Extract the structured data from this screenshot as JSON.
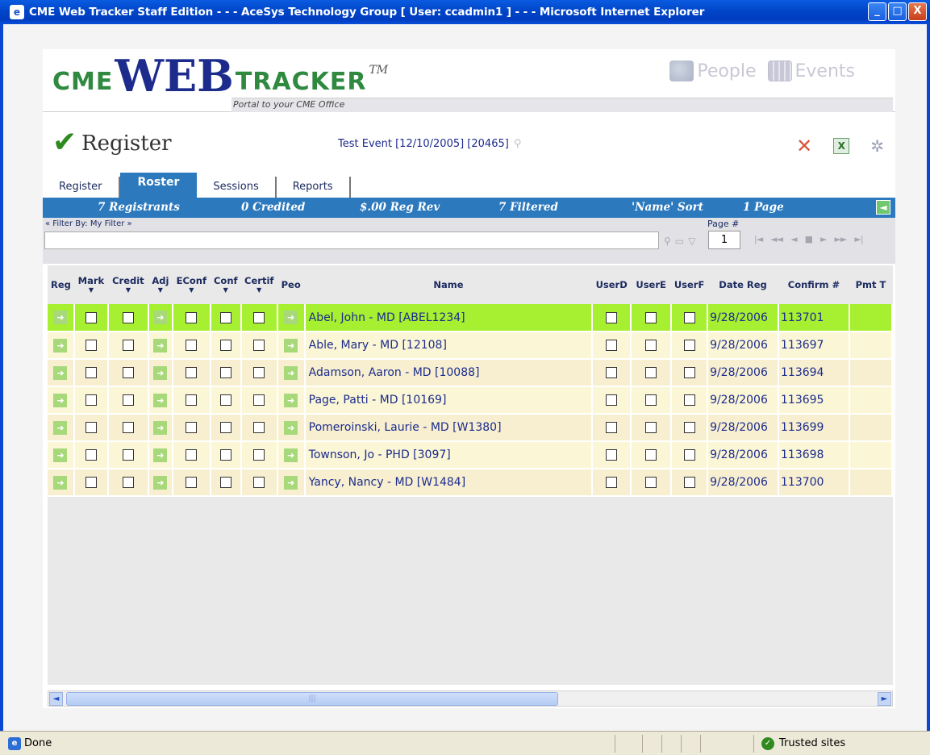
{
  "window": {
    "title": "CME Web Tracker Staff Edition - - - AceSys Technology Group [ User: ccadmin1 ] - - - Microsoft Internet Explorer",
    "minimize_label": "_",
    "maximize_label": "□",
    "close_label": "X"
  },
  "header": {
    "logo_cme": "CME",
    "logo_web": "WEB",
    "logo_tracker": "TRACKER",
    "logo_tm": "TM",
    "tagline": "Portal to your CME Office",
    "nav_people": "People",
    "nav_events": "Events"
  },
  "register": {
    "title": "Register",
    "event": "Test Event [12/10/2005] [20465]"
  },
  "tabs": [
    "Register",
    "Roster",
    "Sessions",
    "Reports"
  ],
  "active_tab": "Roster",
  "stats": {
    "registrants": "7 Registrants",
    "credited": "0 Credited",
    "reg_rev": "$.00 Reg Rev",
    "filtered": "7 Filtered",
    "sort": "'Name' Sort",
    "pages": "1 Page"
  },
  "filter": {
    "label": "« Filter By: My Filter »",
    "value": "",
    "page_label": "Page #",
    "page_value": "1"
  },
  "columns": [
    "Reg",
    "Mark",
    "Credit",
    "Adj",
    "EConf",
    "Conf",
    "Certif",
    "Peo",
    "Name",
    "UserD",
    "UserE",
    "UserF",
    "Date Reg",
    "Confirm #",
    "Pmt T"
  ],
  "rows": [
    {
      "name": "Abel, John - MD [ABEL1234]",
      "date": "9/28/2006",
      "confirm": "113701",
      "selected": true
    },
    {
      "name": "Able, Mary - MD [12108]",
      "date": "9/28/2006",
      "confirm": "113697",
      "selected": false
    },
    {
      "name": "Adamson, Aaron - MD [10088]",
      "date": "9/28/2006",
      "confirm": "113694",
      "selected": false
    },
    {
      "name": "Page, Patti - MD [10169]",
      "date": "9/28/2006",
      "confirm": "113695",
      "selected": false
    },
    {
      "name": "Pomeroinski, Laurie - MD [W1380]",
      "date": "9/28/2006",
      "confirm": "113699",
      "selected": false
    },
    {
      "name": "Townson, Jo - PHD [3097]",
      "date": "9/28/2006",
      "confirm": "113698",
      "selected": false
    },
    {
      "name": "Yancy, Nancy - MD [W1484]",
      "date": "9/28/2006",
      "confirm": "113700",
      "selected": false
    }
  ],
  "status": {
    "text": "Done",
    "zone": "Trusted sites"
  },
  "colors": {
    "accent_blue": "#2c79bd",
    "selected_row": "#a6ef31",
    "row_bg": "#fbf6d5"
  }
}
